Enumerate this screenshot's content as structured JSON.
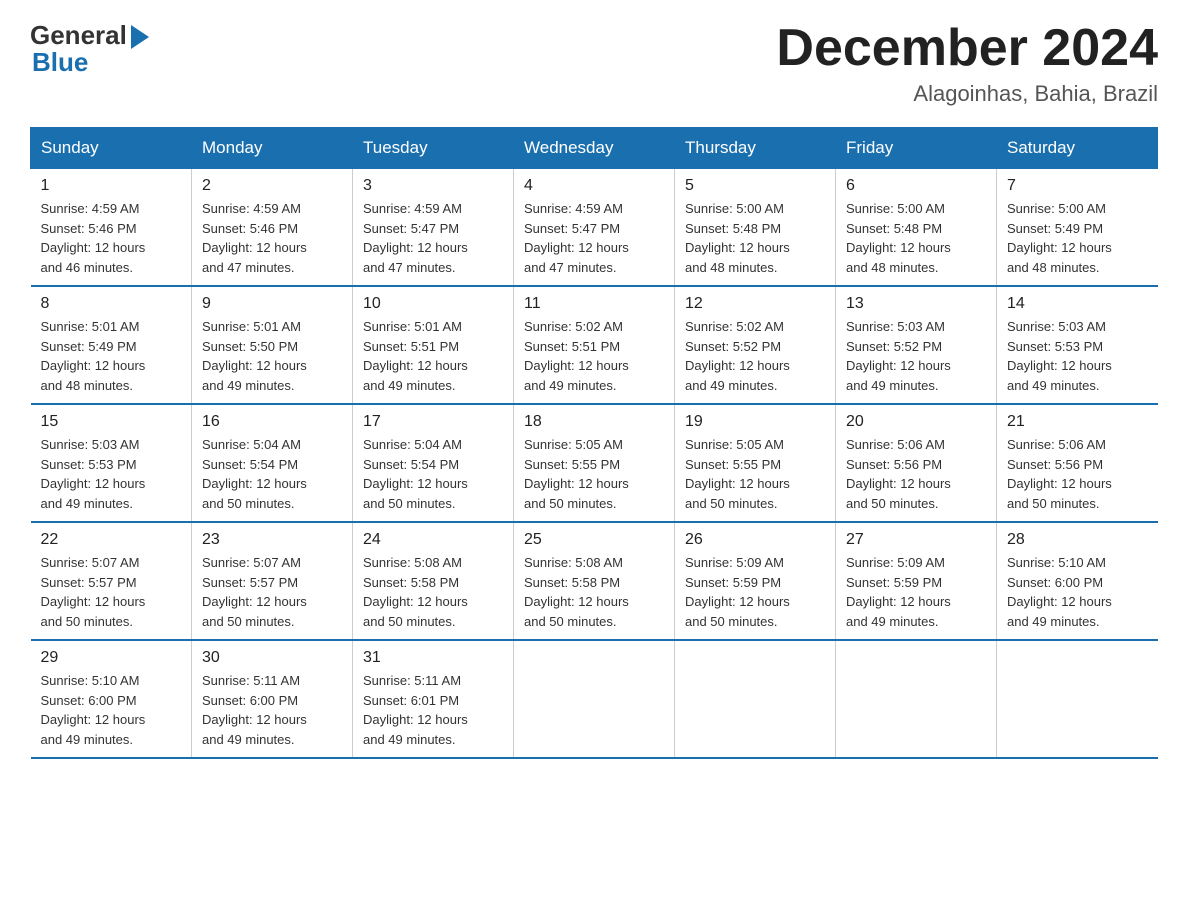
{
  "logo": {
    "general": "General",
    "blue": "Blue"
  },
  "title": "December 2024",
  "location": "Alagoinhas, Bahia, Brazil",
  "days_of_week": [
    "Sunday",
    "Monday",
    "Tuesday",
    "Wednesday",
    "Thursday",
    "Friday",
    "Saturday"
  ],
  "weeks": [
    [
      {
        "day": "1",
        "sunrise": "4:59 AM",
        "sunset": "5:46 PM",
        "daylight": "12 hours and 46 minutes."
      },
      {
        "day": "2",
        "sunrise": "4:59 AM",
        "sunset": "5:46 PM",
        "daylight": "12 hours and 47 minutes."
      },
      {
        "day": "3",
        "sunrise": "4:59 AM",
        "sunset": "5:47 PM",
        "daylight": "12 hours and 47 minutes."
      },
      {
        "day": "4",
        "sunrise": "4:59 AM",
        "sunset": "5:47 PM",
        "daylight": "12 hours and 47 minutes."
      },
      {
        "day": "5",
        "sunrise": "5:00 AM",
        "sunset": "5:48 PM",
        "daylight": "12 hours and 48 minutes."
      },
      {
        "day": "6",
        "sunrise": "5:00 AM",
        "sunset": "5:48 PM",
        "daylight": "12 hours and 48 minutes."
      },
      {
        "day": "7",
        "sunrise": "5:00 AM",
        "sunset": "5:49 PM",
        "daylight": "12 hours and 48 minutes."
      }
    ],
    [
      {
        "day": "8",
        "sunrise": "5:01 AM",
        "sunset": "5:49 PM",
        "daylight": "12 hours and 48 minutes."
      },
      {
        "day": "9",
        "sunrise": "5:01 AM",
        "sunset": "5:50 PM",
        "daylight": "12 hours and 49 minutes."
      },
      {
        "day": "10",
        "sunrise": "5:01 AM",
        "sunset": "5:51 PM",
        "daylight": "12 hours and 49 minutes."
      },
      {
        "day": "11",
        "sunrise": "5:02 AM",
        "sunset": "5:51 PM",
        "daylight": "12 hours and 49 minutes."
      },
      {
        "day": "12",
        "sunrise": "5:02 AM",
        "sunset": "5:52 PM",
        "daylight": "12 hours and 49 minutes."
      },
      {
        "day": "13",
        "sunrise": "5:03 AM",
        "sunset": "5:52 PM",
        "daylight": "12 hours and 49 minutes."
      },
      {
        "day": "14",
        "sunrise": "5:03 AM",
        "sunset": "5:53 PM",
        "daylight": "12 hours and 49 minutes."
      }
    ],
    [
      {
        "day": "15",
        "sunrise": "5:03 AM",
        "sunset": "5:53 PM",
        "daylight": "12 hours and 49 minutes."
      },
      {
        "day": "16",
        "sunrise": "5:04 AM",
        "sunset": "5:54 PM",
        "daylight": "12 hours and 50 minutes."
      },
      {
        "day": "17",
        "sunrise": "5:04 AM",
        "sunset": "5:54 PM",
        "daylight": "12 hours and 50 minutes."
      },
      {
        "day": "18",
        "sunrise": "5:05 AM",
        "sunset": "5:55 PM",
        "daylight": "12 hours and 50 minutes."
      },
      {
        "day": "19",
        "sunrise": "5:05 AM",
        "sunset": "5:55 PM",
        "daylight": "12 hours and 50 minutes."
      },
      {
        "day": "20",
        "sunrise": "5:06 AM",
        "sunset": "5:56 PM",
        "daylight": "12 hours and 50 minutes."
      },
      {
        "day": "21",
        "sunrise": "5:06 AM",
        "sunset": "5:56 PM",
        "daylight": "12 hours and 50 minutes."
      }
    ],
    [
      {
        "day": "22",
        "sunrise": "5:07 AM",
        "sunset": "5:57 PM",
        "daylight": "12 hours and 50 minutes."
      },
      {
        "day": "23",
        "sunrise": "5:07 AM",
        "sunset": "5:57 PM",
        "daylight": "12 hours and 50 minutes."
      },
      {
        "day": "24",
        "sunrise": "5:08 AM",
        "sunset": "5:58 PM",
        "daylight": "12 hours and 50 minutes."
      },
      {
        "day": "25",
        "sunrise": "5:08 AM",
        "sunset": "5:58 PM",
        "daylight": "12 hours and 50 minutes."
      },
      {
        "day": "26",
        "sunrise": "5:09 AM",
        "sunset": "5:59 PM",
        "daylight": "12 hours and 50 minutes."
      },
      {
        "day": "27",
        "sunrise": "5:09 AM",
        "sunset": "5:59 PM",
        "daylight": "12 hours and 49 minutes."
      },
      {
        "day": "28",
        "sunrise": "5:10 AM",
        "sunset": "6:00 PM",
        "daylight": "12 hours and 49 minutes."
      }
    ],
    [
      {
        "day": "29",
        "sunrise": "5:10 AM",
        "sunset": "6:00 PM",
        "daylight": "12 hours and 49 minutes."
      },
      {
        "day": "30",
        "sunrise": "5:11 AM",
        "sunset": "6:00 PM",
        "daylight": "12 hours and 49 minutes."
      },
      {
        "day": "31",
        "sunrise": "5:11 AM",
        "sunset": "6:01 PM",
        "daylight": "12 hours and 49 minutes."
      },
      null,
      null,
      null,
      null
    ]
  ]
}
